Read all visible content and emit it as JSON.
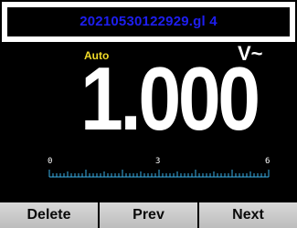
{
  "header": {
    "filename": "20210530122929.gl 4"
  },
  "measurement": {
    "mode": "Auto",
    "unit": "V~",
    "value": "1.000"
  },
  "scale": {
    "min_label": "0",
    "mid_label": "3",
    "max_label": "6"
  },
  "colors": {
    "title": "#1e1ef0",
    "mode": "#f2dc28",
    "reading": "#ffffff",
    "scale_ticks": "#3ab0e8"
  },
  "softkeys": [
    {
      "label": "Delete"
    },
    {
      "label": "Prev"
    },
    {
      "label": "Next"
    }
  ]
}
